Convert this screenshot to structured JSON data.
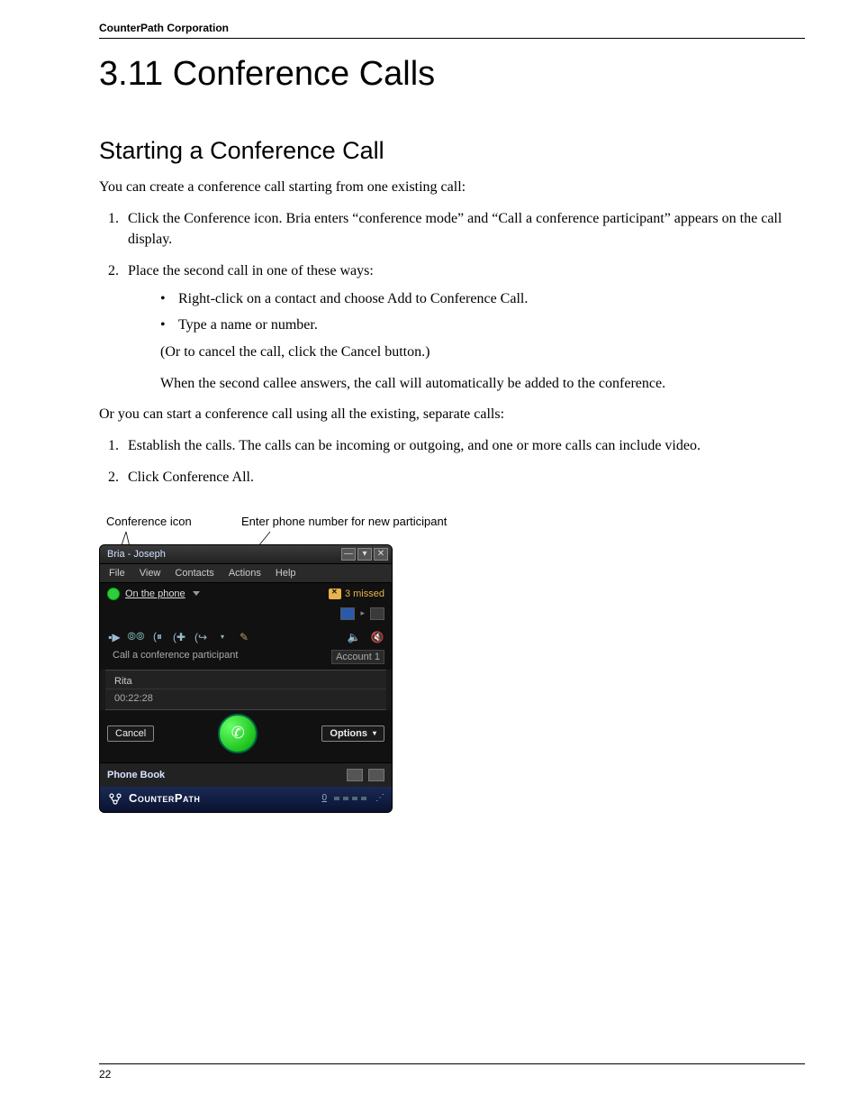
{
  "header": {
    "running": "CounterPath Corporation"
  },
  "title": "3.11 Conference Calls",
  "subtitle": "Starting a Conference Call",
  "intro": "You can create a conference call starting from one existing call:",
  "steps1": {
    "s1": "Click the Conference icon. Bria enters “conference mode” and “Call a conference participant” appears on the call display.",
    "s2": "Place the second call in one of these ways:",
    "sub1": "Right-click on a contact and choose Add to Conference Call.",
    "sub2": "Type a name or number.",
    "note1": "(Or to cancel the call, click the Cancel button.)",
    "note2": "When the second callee answers, the call will automatically be added to the conference."
  },
  "intro2": "Or you can start a conference call using all the existing, separate calls:",
  "steps2": {
    "s1": "Establish the calls. The calls can be incoming or outgoing, and one or more calls can include video.",
    "s2": "Click Conference All."
  },
  "callout": {
    "c1": "Conference icon",
    "c2": "Enter phone number for new participant"
  },
  "app": {
    "title": "Bria - Joseph",
    "menu": {
      "file": "File",
      "view": "View",
      "contacts": "Contacts",
      "actions": "Actions",
      "help": "Help"
    },
    "status": "On the phone",
    "missed": "3 missed",
    "input_placeholder": "Call a conference participant",
    "account": "Account 1",
    "caller": "Rita",
    "timer": "00:22:28",
    "cancel": "Cancel",
    "options": "Options",
    "phonebook": "Phone Book",
    "brand": "CounterPath",
    "brand_count": "0"
  },
  "footer": {
    "page": "22"
  }
}
